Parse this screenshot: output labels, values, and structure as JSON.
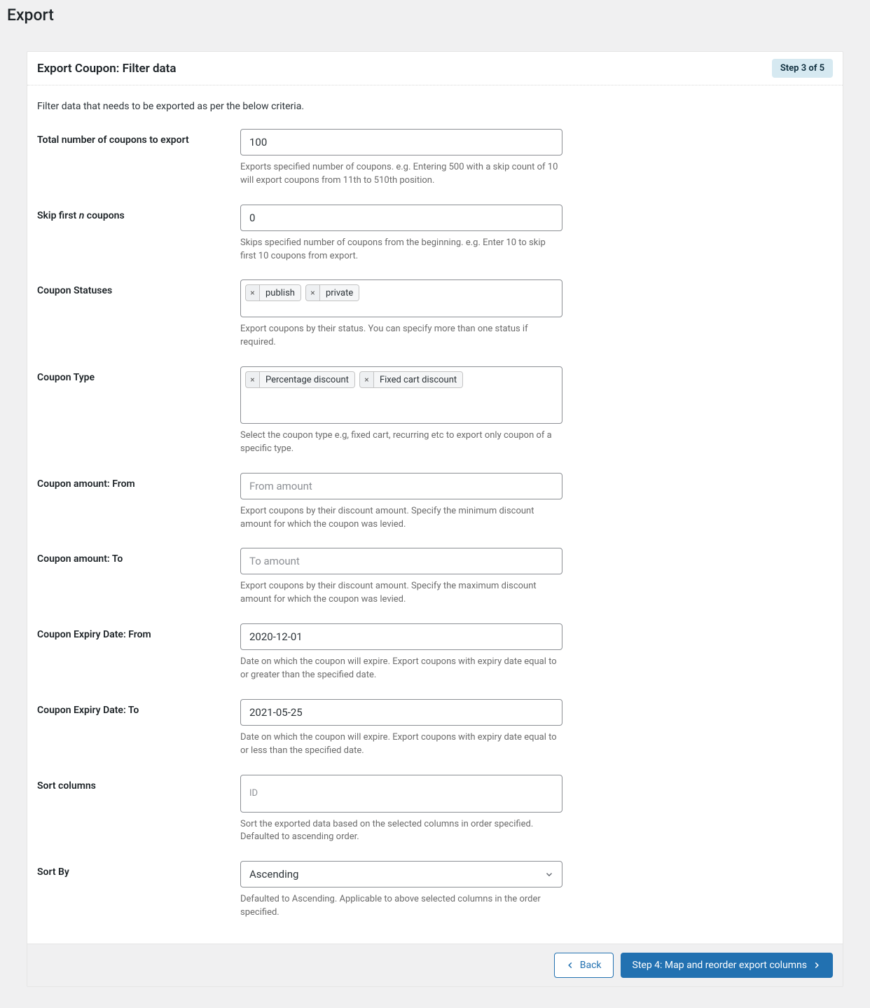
{
  "page_title": "Export",
  "panel": {
    "title": "Export Coupon: Filter data",
    "step_badge": "Step 3 of 5"
  },
  "intro": "Filter data that needs to be exported as per the below criteria.",
  "fields": {
    "total": {
      "label": "Total number of coupons to export",
      "value": "100",
      "help": "Exports specified number of coupons. e.g. Entering 500 with a skip count of 10 will export coupons from 11th to 510th position."
    },
    "skip": {
      "label_pre": "Skip first ",
      "label_ital": "n",
      "label_post": " coupons",
      "value": "0",
      "help": "Skips specified number of coupons from the beginning. e.g. Enter 10 to skip first 10 coupons from export."
    },
    "statuses": {
      "label": "Coupon Statuses",
      "tags": [
        "publish",
        "private"
      ],
      "help": "Export coupons by their status. You can specify more than one status if required."
    },
    "type": {
      "label": "Coupon Type",
      "tags": [
        "Percentage discount",
        "Fixed cart discount"
      ],
      "help": "Select the coupon type e.g, fixed cart, recurring etc to export only coupon of a specific type."
    },
    "amount_from": {
      "label": "Coupon amount: From",
      "placeholder": "From amount",
      "value": "",
      "help": "Export coupons by their discount amount. Specify the minimum discount amount for which the coupon was levied."
    },
    "amount_to": {
      "label": "Coupon amount: To",
      "placeholder": "To amount",
      "value": "",
      "help": "Export coupons by their discount amount. Specify the maximum discount amount for which the coupon was levied."
    },
    "expiry_from": {
      "label": "Coupon Expiry Date: From",
      "value": "2020-12-01",
      "help": "Date on which the coupon will expire. Export coupons with expiry date equal to or greater than the specified date."
    },
    "expiry_to": {
      "label": "Coupon Expiry Date: To",
      "value": "2021-05-25",
      "help": "Date on which the coupon will expire. Export coupons with expiry date equal to or less than the specified date."
    },
    "sort_columns": {
      "label": "Sort columns",
      "placeholder": "ID",
      "help": "Sort the exported data based on the selected columns in order specified. Defaulted to ascending order."
    },
    "sort_by": {
      "label": "Sort By",
      "value": "Ascending",
      "help": "Defaulted to Ascending. Applicable to above selected columns in the order specified."
    }
  },
  "footer": {
    "back": "Back",
    "next": "Step 4: Map and reorder export columns"
  },
  "icons": {
    "remove": "×"
  }
}
